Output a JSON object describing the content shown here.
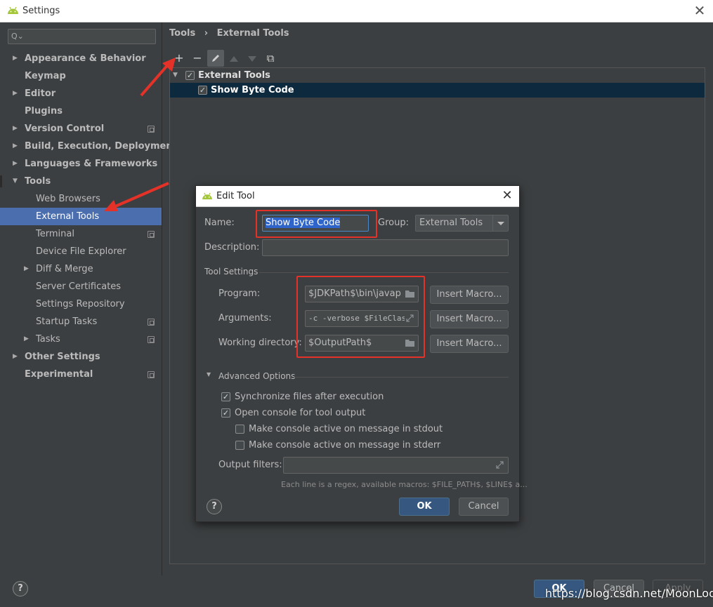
{
  "window": {
    "title": "Settings"
  },
  "sidebar": {
    "search_placeholder": "",
    "items": [
      {
        "label": "Appearance & Behavior",
        "bold": true,
        "arrow": "▶"
      },
      {
        "label": "Keymap",
        "bold": true,
        "arrow": ""
      },
      {
        "label": "Editor",
        "bold": true,
        "arrow": "▶"
      },
      {
        "label": "Plugins",
        "bold": true,
        "arrow": ""
      },
      {
        "label": "Version Control",
        "bold": true,
        "arrow": "▶"
      },
      {
        "label": "Build, Execution, Deployment",
        "bold": true,
        "arrow": "▶"
      },
      {
        "label": "Languages & Frameworks",
        "bold": true,
        "arrow": "▶"
      },
      {
        "label": "Tools",
        "bold": true,
        "arrow": "▼"
      },
      {
        "label": "Web Browsers",
        "bold": false,
        "arrow": ""
      },
      {
        "label": "External Tools",
        "bold": false,
        "arrow": ""
      },
      {
        "label": "Terminal",
        "bold": false,
        "arrow": ""
      },
      {
        "label": "Device File Explorer",
        "bold": false,
        "arrow": ""
      },
      {
        "label": "Diff & Merge",
        "bold": false,
        "arrow": "▶"
      },
      {
        "label": "Server Certificates",
        "bold": false,
        "arrow": ""
      },
      {
        "label": "Settings Repository",
        "bold": false,
        "arrow": ""
      },
      {
        "label": "Startup Tasks",
        "bold": false,
        "arrow": ""
      },
      {
        "label": "Tasks",
        "bold": false,
        "arrow": "▶"
      },
      {
        "label": "Other Settings",
        "bold": true,
        "arrow": "▶"
      },
      {
        "label": "Experimental",
        "bold": true,
        "arrow": ""
      }
    ]
  },
  "breadcrumb": {
    "parent": "Tools",
    "separator": "›",
    "current": "External Tools"
  },
  "toolbar": {
    "add": "+",
    "remove": "−",
    "copy": "⧉"
  },
  "tool_tree": {
    "group_label": "External Tools",
    "tool_label": "Show Byte Code"
  },
  "dialog": {
    "title": "Edit Tool",
    "name_label": "Name:",
    "name_value": "Show Byte Code",
    "group_label": "Group:",
    "group_value": "External Tools",
    "description_label": "Description:",
    "description_value": "",
    "tool_settings_header": "Tool Settings",
    "program_label": "Program:",
    "program_value": "$JDKPath$\\bin\\javap",
    "arguments_label": "Arguments:",
    "arguments_value": "-c -verbose $FileClass$",
    "workdir_label": "Working directory:",
    "workdir_value": "$OutputPath$",
    "insert_macro": "Insert Macro...",
    "advanced_header": "Advanced Options",
    "opt_sync": "Synchronize files after execution",
    "opt_console": "Open console for tool output",
    "opt_stdout": "Make console active on message in stdout",
    "opt_stderr": "Make console active on message in stderr",
    "output_filters_label": "Output filters:",
    "output_filters_value": "",
    "hint": "Each line is a regex, available macros: $FILE_PATH$, $LINE$ a...",
    "help": "?",
    "ok": "OK",
    "cancel": "Cancel"
  },
  "footer": {
    "help": "?",
    "ok": "OK",
    "cancel": "Cancel",
    "apply": "Apply"
  },
  "watermark": "https://blog.csdn.net/MoonLoong",
  "colors": {
    "background": "#3c3f41",
    "selection": "#4b6eaf",
    "tree_selection": "#0d293e",
    "primary_button": "#365880",
    "annotation_red": "#e53229",
    "android_green": "#a4c639"
  }
}
